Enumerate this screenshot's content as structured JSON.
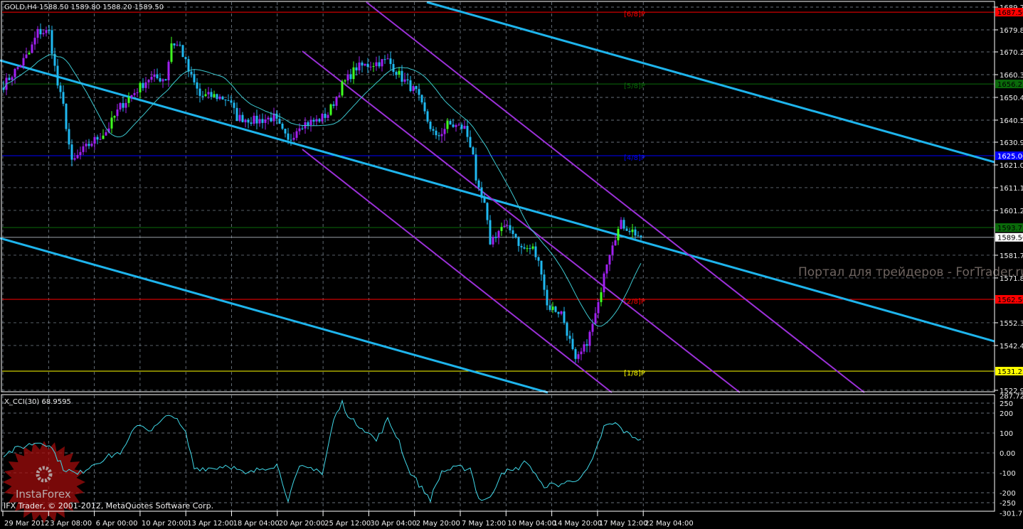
{
  "header": {
    "symbol_info": "GOLD,H4  1588.50 1589.80 1588.20 1589.50"
  },
  "indicator_label": "X_CCI(30) 68.9595",
  "copyright": "IFX Trader, © 2001-2012, MetaQuotes Software Corp.",
  "watermark": "Портал для трейдеров - ForTrader.ru",
  "logo_text": "InstaForex",
  "colors": {
    "background": "#000000",
    "grid": "#8a96a3",
    "up_candle": "#a020f0",
    "down_candle": "#1fb8f0",
    "ma_line": "#3cc8d0",
    "trend_line": "#1eb4ec",
    "channel_line": "#9b30d8",
    "cci_line": "#40d8e8"
  },
  "chart_data": [
    {
      "type": "candlestick",
      "title": "GOLD,H4",
      "ohlc_last": {
        "open": 1588.5,
        "high": 1589.8,
        "low": 1588.2,
        "close": 1589.5
      },
      "ylim": [
        1522.9,
        1689.7
      ],
      "y_ticks": [
        "1689.70",
        "1679.80",
        "1670.20",
        "1660.30",
        "1650.40",
        "1640.50",
        "1630.90",
        "1621.00",
        "1611.10",
        "1601.20",
        "1581.70",
        "1571.80",
        "1552.30",
        "1542.40",
        "1522.90"
      ],
      "x_ticks": [
        "29 Mar 2012",
        "3 Apr 08:00",
        "6 Apr 00:00",
        "10 Apr 20:00",
        "13 Apr 12:00",
        "18 Apr 04:00",
        "20 Apr 20:00",
        "25 Apr 12:00",
        "30 Apr 04:00",
        "2 May 20:00",
        "7 May 12:00",
        "10 May 04:00",
        "14 May 20:00",
        "17 May 12:00",
        "22 May 04:00"
      ],
      "close_path": [
        [
          0,
          1655.7
        ],
        [
          9,
          1669.6
        ],
        [
          12,
          1678.9
        ],
        [
          16,
          1678.9
        ],
        [
          19,
          1655.7
        ],
        [
          21,
          1646.4
        ],
        [
          24,
          1621.6
        ],
        [
          27,
          1626.3
        ],
        [
          31,
          1630.9
        ],
        [
          36,
          1635.5
        ],
        [
          41,
          1646.4
        ],
        [
          46,
          1652.6
        ],
        [
          51,
          1658.7
        ],
        [
          57,
          1658.7
        ],
        [
          59,
          1674.2
        ],
        [
          62,
          1672.7
        ],
        [
          65,
          1661.8
        ],
        [
          69,
          1651.0
        ],
        [
          74,
          1651.0
        ],
        [
          79,
          1649.5
        ],
        [
          82,
          1641.7
        ],
        [
          89,
          1640.2
        ],
        [
          95,
          1641.7
        ],
        [
          100,
          1630.9
        ],
        [
          104,
          1638.6
        ],
        [
          110,
          1640.2
        ],
        [
          114,
          1643.3
        ],
        [
          119,
          1655.7
        ],
        [
          124,
          1663.4
        ],
        [
          129,
          1664.9
        ],
        [
          135,
          1666.5
        ],
        [
          140,
          1658.7
        ],
        [
          145,
          1652.6
        ],
        [
          149,
          1640.2
        ],
        [
          152,
          1632.4
        ],
        [
          156,
          1638.6
        ],
        [
          162,
          1637.1
        ],
        [
          165,
          1626.3
        ],
        [
          166,
          1612.3
        ],
        [
          169,
          1603.0
        ],
        [
          171,
          1587.6
        ],
        [
          175,
          1593.8
        ],
        [
          179,
          1592.2
        ],
        [
          182,
          1584.5
        ],
        [
          186,
          1584.5
        ],
        [
          189,
          1575.2
        ],
        [
          191,
          1559.7
        ],
        [
          196,
          1556.6
        ],
        [
          199,
          1544.2
        ],
        [
          201,
          1534.9
        ],
        [
          204,
          1541.1
        ],
        [
          206,
          1547.3
        ],
        [
          209,
          1559.7
        ],
        [
          211,
          1575.2
        ],
        [
          214,
          1587.6
        ],
        [
          217,
          1595.3
        ],
        [
          221,
          1592.2
        ],
        [
          224,
          1589.5
        ]
      ],
      "ma_period": 20,
      "murrey_levels": [
        {
          "label": "[6/8]P",
          "price": 1687.5,
          "tag": "1687.50",
          "color": "#ff0000"
        },
        {
          "label": "[5/8]P",
          "price": 1656.25,
          "tag": "1656.25",
          "color": "#0a6a0a"
        },
        {
          "label": "[4/8]P",
          "price": 1625.0,
          "tag": "1625.00",
          "color": "#0000ff"
        },
        {
          "label": "",
          "price": 1593.75,
          "tag": "1593.75",
          "color": "#0a6a0a"
        },
        {
          "label": "[2/8]P",
          "price": 1562.5,
          "tag": "1562.50",
          "color": "#ff0000"
        },
        {
          "label": "[1/8]P",
          "price": 1531.25,
          "tag": "1531.25",
          "color": "#ffff00"
        }
      ],
      "current_price": {
        "price": 1589.5,
        "tag": "1589.50"
      }
    },
    {
      "type": "line",
      "title": "X_CCI(30)",
      "last_value": 68.9595,
      "ylim": [
        -301.736,
        287.724
      ],
      "y_ticks": [
        "287.724",
        "250",
        "200",
        "100",
        "0.00",
        "-100",
        "-200",
        "-250",
        "-301.736"
      ],
      "path": [
        [
          0,
          -7
        ],
        [
          6,
          28
        ],
        [
          12,
          55
        ],
        [
          16,
          45
        ],
        [
          21,
          -76
        ],
        [
          26,
          -110
        ],
        [
          31,
          -59
        ],
        [
          36,
          -24
        ],
        [
          42,
          10
        ],
        [
          47,
          148
        ],
        [
          52,
          114
        ],
        [
          59,
          200
        ],
        [
          64,
          97
        ],
        [
          67,
          -76
        ],
        [
          74,
          -76
        ],
        [
          79,
          -59
        ],
        [
          85,
          -110
        ],
        [
          91,
          -76
        ],
        [
          96,
          -59
        ],
        [
          100,
          -231
        ],
        [
          104,
          -76
        ],
        [
          110,
          -76
        ],
        [
          112,
          -110
        ],
        [
          116,
          166
        ],
        [
          119,
          252
        ],
        [
          122,
          166
        ],
        [
          126,
          131
        ],
        [
          131,
          62
        ],
        [
          135,
          166
        ],
        [
          139,
          62
        ],
        [
          142,
          -76
        ],
        [
          147,
          -179
        ],
        [
          150,
          -231
        ],
        [
          154,
          -93
        ],
        [
          159,
          -76
        ],
        [
          164,
          -76
        ],
        [
          167,
          -231
        ],
        [
          171,
          -231
        ],
        [
          175,
          -93
        ],
        [
          179,
          -93
        ],
        [
          184,
          -41
        ],
        [
          189,
          -162
        ],
        [
          194,
          -162
        ],
        [
          199,
          -145
        ],
        [
          204,
          -110
        ],
        [
          207,
          -41
        ],
        [
          211,
          131
        ],
        [
          215,
          148
        ],
        [
          219,
          97
        ],
        [
          224,
          69
        ]
      ]
    }
  ]
}
